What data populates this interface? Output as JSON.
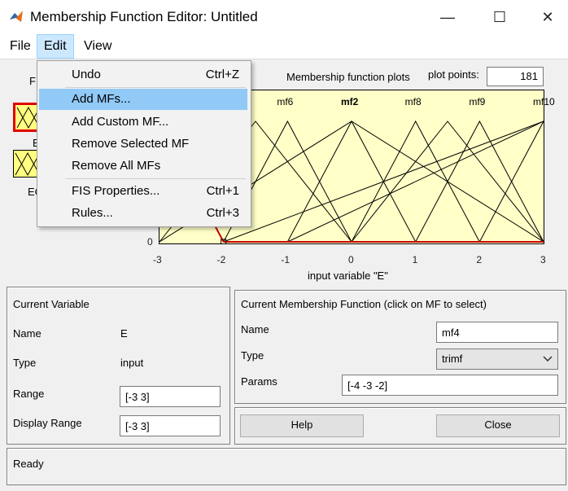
{
  "window": {
    "title": "Membership Function Editor: Untitled",
    "controls": {
      "minimize": "—",
      "maximize": "☐",
      "close": "✕"
    }
  },
  "menubar": {
    "file": "File",
    "edit": "Edit",
    "view": "View"
  },
  "edit_menu": {
    "items": [
      {
        "label": "Undo",
        "shortcut": "Ctrl+Z"
      },
      {
        "label": "Add MFs...",
        "shortcut": ""
      },
      {
        "label": "Add Custom MF...",
        "shortcut": ""
      },
      {
        "label": "Remove Selected MF",
        "shortcut": ""
      },
      {
        "label": "Remove All MFs",
        "shortcut": ""
      },
      {
        "label": "FIS Properties...",
        "shortcut": "Ctrl+1"
      },
      {
        "label": "Rules...",
        "shortcut": "Ctrl+3"
      }
    ],
    "highlighted": "Add MFs..."
  },
  "fis_variables": {
    "header_partial": "F",
    "var1_label_partial": "E",
    "var2_label_partial": "EC"
  },
  "plot": {
    "title": "Membership function plots",
    "plot_points_label": "plot points:",
    "plot_points_value": "181",
    "xlabel": "input variable \"E\"",
    "x_ticks": [
      "-3",
      "-2",
      "-1",
      "0",
      "1",
      "2",
      "3"
    ],
    "y_tick_zero": "0",
    "mf_labels": [
      "mf6",
      "mf2",
      "mf8",
      "mf9",
      "mf10"
    ],
    "colors": {
      "plot_bg": "#ffffc7",
      "selected_mf": "#cc0000",
      "mf_line": "#000000"
    }
  },
  "chart_data": {
    "type": "line",
    "xlim": [
      -3,
      3
    ],
    "ylim": [
      0,
      1
    ],
    "xlabel": "input variable \"E\"",
    "series": [
      {
        "name": "mf4",
        "selected": true,
        "points": [
          [
            -4,
            0
          ],
          [
            -3,
            1
          ],
          [
            -2,
            0
          ]
        ]
      },
      {
        "name": "mf6",
        "points": [
          [
            -2,
            0
          ],
          [
            -1,
            1
          ],
          [
            0,
            0
          ]
        ]
      },
      {
        "name": "mf2",
        "points": [
          [
            -1,
            0
          ],
          [
            0,
            1
          ],
          [
            1,
            0
          ]
        ]
      },
      {
        "name": "mf8",
        "points": [
          [
            0,
            0
          ],
          [
            1,
            1
          ],
          [
            2,
            0
          ]
        ]
      },
      {
        "name": "mf9",
        "points": [
          [
            1,
            0
          ],
          [
            2,
            1
          ],
          [
            3,
            0
          ]
        ]
      },
      {
        "name": "mf10",
        "points": [
          [
            2,
            0
          ],
          [
            3,
            1
          ],
          [
            4,
            0
          ]
        ]
      },
      {
        "name": "",
        "points": [
          [
            -3,
            0
          ],
          [
            -1.5,
            1
          ],
          [
            0,
            0
          ]
        ]
      },
      {
        "name": "",
        "points": [
          [
            -3,
            0
          ],
          [
            0,
            1
          ],
          [
            3,
            0
          ]
        ]
      },
      {
        "name": "",
        "points": [
          [
            0,
            0
          ],
          [
            1.5,
            1
          ],
          [
            3,
            0
          ]
        ]
      },
      {
        "name": "",
        "points": [
          [
            -2,
            0
          ],
          [
            3,
            1
          ]
        ]
      },
      {
        "name": "",
        "points": [
          [
            -1,
            0
          ],
          [
            3,
            1
          ]
        ]
      }
    ],
    "mf_label_positions": [
      -1,
      0,
      1,
      2,
      3
    ]
  },
  "current_variable": {
    "header": "Current Variable",
    "name_label": "Name",
    "name_value": "E",
    "type_label": "Type",
    "type_value": "input",
    "range_label": "Range",
    "range_value": "[-3 3]",
    "display_range_label": "Display Range",
    "display_range_value": "[-3 3]"
  },
  "current_mf": {
    "header": "Current Membership Function (click on MF to select)",
    "name_label": "Name",
    "name_value": "mf4",
    "type_label": "Type",
    "type_value": "trimf",
    "params_label": "Params",
    "params_value": "[-4 -3 -2]"
  },
  "buttons": {
    "help": "Help",
    "close": "Close"
  },
  "status": {
    "text": "Ready"
  }
}
